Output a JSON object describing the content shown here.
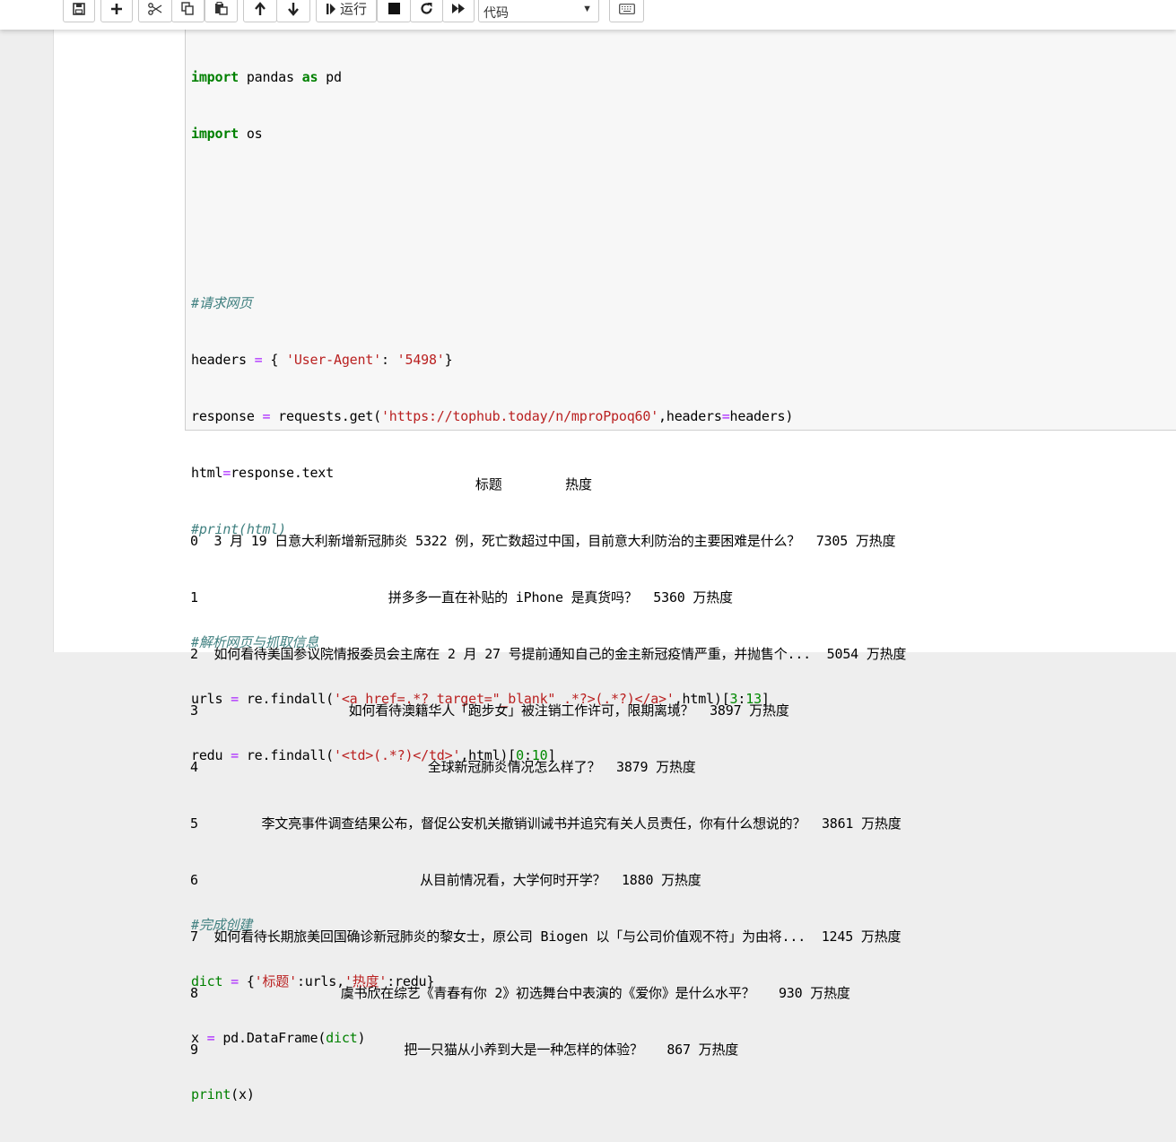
{
  "toolbar": {
    "buttons": [
      "save-icon",
      "plus-icon",
      "scissors-icon",
      "copy-icon",
      "paste-icon",
      "arrow-up-icon",
      "arrow-down-icon"
    ],
    "run_label": "运行",
    "cell_type": "代码"
  },
  "code": {
    "l1_kw": "import",
    "l1_rest": " pandas ",
    "l1_kw2": "as",
    "l1_end": " pd",
    "l2_kw": "import",
    "l2_rest": " os",
    "c1": "#请求网页",
    "l4a": "headers ",
    "l4op": "=",
    "l4b": " { ",
    "l4s1": "'User-Agent'",
    "l4c": ": ",
    "l4s2": "'5498'",
    "l4d": "}",
    "l5a": "response ",
    "l5op": "=",
    "l5b": " requests.get(",
    "l5s": "'https://tophub.today/n/mproPpoq60'",
    "l5c": ",headers",
    "l5op2": "=",
    "l5d": "headers)",
    "l6a": "html",
    "l6op": "=",
    "l6b": "response.text",
    "c2": "#print(html)",
    "c3": "#解析网页与抓取信息",
    "l9a": "urls ",
    "l9op": "=",
    "l9b": " re.findall(",
    "l9s": "'<a href=.*? target=\"_blank\" .*?>(.*?)</a>'",
    "l9c": ",html)[",
    "l9n1": "3",
    "l9d": ":",
    "l9n2": "13",
    "l9e": "]",
    "l10a": "redu ",
    "l10op": "=",
    "l10b": " re.findall(",
    "l10s": "'<td>(.*?)</td>'",
    "l10c": ",html)[",
    "l10n1": "0",
    "l10d": ":",
    "l10n2": "10",
    "l10e": "]",
    "c4": "#完成创建",
    "l12a": "dict",
    "l12op": " = ",
    "l12b": "{",
    "l12s1": "'标题'",
    "l12c": ":urls,",
    "l12s2": "'热度'",
    "l12d": ":redu}",
    "l13a": "x ",
    "l13op": "=",
    "l13b": " pd.DataFrame(",
    "l13c": "dict",
    "l13d": ")",
    "l14a": "print",
    "l14b": "(x)"
  },
  "output": {
    "header": "                                    标题        热度",
    "rows": [
      "0  3 月 19 日意大利新增新冠肺炎 5322 例，死亡数超过中国，目前意大利防治的主要困难是什么？  7305 万热度",
      "1                        拼多多一直在补贴的 iPhone 是真货吗？  5360 万热度",
      "2  如何看待美国参议院情报委员会主席在 2 月 27 号提前通知自己的金主新冠疫情严重，并抛售个...  5054 万热度",
      "3                   如何看待澳籍华人「跑步女」被注销工作许可，限期离境？  3897 万热度",
      "4                             全球新冠肺炎情况怎么样了？  3879 万热度",
      "5        李文亮事件调查结果公布，督促公安机关撤销训诫书并追究有关人员责任，你有什么想说的？  3861 万热度",
      "6                            从目前情况看，大学何时开学？  1880 万热度",
      "7  如何看待长期旅美回国确诊新冠肺炎的黎女士，原公司 Biogen 以「与公司价值观不符」为由将...  1245 万热度",
      "8                  虞书欣在综艺《青春有你 2》初选舞台中表演的《爱你》是什么水平？   930 万热度",
      "9                          把一只猫从小养到大是一种怎样的体验？   867 万热度"
    ]
  }
}
